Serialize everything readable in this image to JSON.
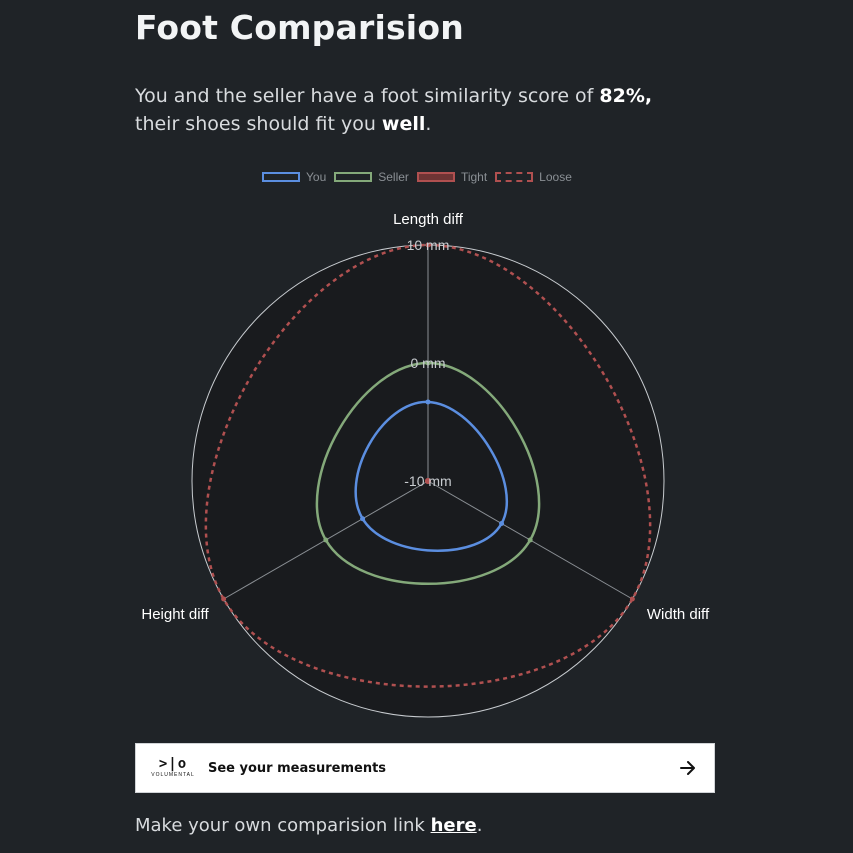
{
  "page": {
    "title": "Foot Comparision",
    "intro": {
      "prefix": "You and the seller have a foot similarity score of ",
      "score": "82%,",
      "middle": " their shoes should fit you ",
      "fit": "well",
      "suffix": "."
    }
  },
  "legend": [
    {
      "label": "You",
      "color": "#5b8ee0",
      "style": "solid"
    },
    {
      "label": "Seller",
      "color": "#84a97a",
      "style": "solid"
    },
    {
      "label": "Tight",
      "color": "#b05050",
      "style": "filled"
    },
    {
      "label": "Loose",
      "color": "#b05050",
      "style": "dashed"
    }
  ],
  "chart_data": {
    "type": "radar",
    "axes": [
      "Length diff",
      "Width diff",
      "Height diff"
    ],
    "tick_labels": [
      "-10 mm",
      "0 mm",
      "10 mm"
    ],
    "range": [
      -10,
      10
    ],
    "series": [
      {
        "name": "You",
        "values": [
          -3.3,
          -2.8,
          -3.6
        ],
        "color": "#5b8ee0"
      },
      {
        "name": "Seller",
        "values": [
          0,
          0,
          0
        ],
        "color": "#84a97a"
      },
      {
        "name": "Tight",
        "values": [
          -10,
          -10,
          -10
        ],
        "color": "#b05050"
      },
      {
        "name": "Loose",
        "values": [
          10,
          10,
          10
        ],
        "color": "#b05050"
      }
    ]
  },
  "card": {
    "label": "See your measurements",
    "logo_mark": ">|o",
    "logo_word": "VOLUMENTAL"
  },
  "footer": {
    "prefix": "Make your own comparision link ",
    "link": "here",
    "suffix": "."
  }
}
